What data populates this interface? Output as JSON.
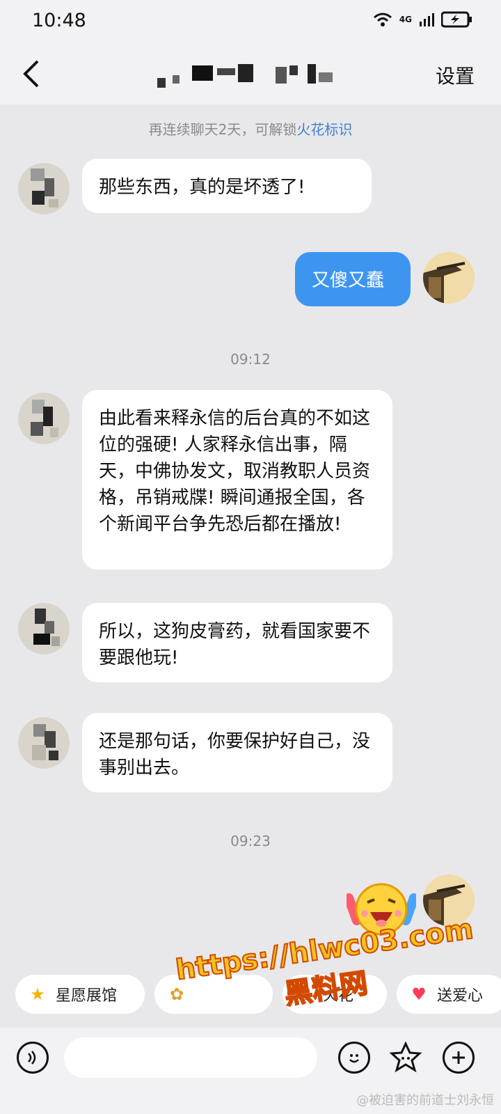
{
  "status": {
    "time": "10:48",
    "network": "4G"
  },
  "header": {
    "settings_label": "设置"
  },
  "notice": {
    "prefix": "再连续聊天2天，可解锁",
    "accent": "火花标识"
  },
  "messages": [
    {
      "side": "left",
      "text": "那些东西，真的是坏透了!"
    },
    {
      "side": "right",
      "text": "又傻又蠢"
    },
    {
      "side": "left",
      "text": "由此看来释永信的后台真的不如这位的强硬! 人家释永信出事，隔天，中佛协发文，取消教职人员资格，吊销戒牒! 瞬间通报全国，各个新闻平台争先恐后都在播放!"
    },
    {
      "side": "left",
      "text": "所以，这狗皮膏药，就看国家要不要跟他玩!"
    },
    {
      "side": "left",
      "text": "还是那句话，你要保护好自己，没事别出去。"
    }
  ],
  "timestamps": [
    "09:12",
    "09:23"
  ],
  "quickbar": [
    {
      "label": "星愿展馆",
      "icon": "star-icon"
    },
    {
      "label": "",
      "icon": "paw-icon"
    },
    {
      "label": "火花",
      "icon": "fire-icon"
    },
    {
      "label": "送爱心",
      "icon": "heart-icon"
    }
  ],
  "watermark": {
    "url": "https://hlwc03.com",
    "cn": "黑料网"
  },
  "credit": "@被迫害的前道士刘永恒",
  "colors": {
    "self_bubble": "#3d95f0",
    "accent": "#3f7fd6"
  }
}
